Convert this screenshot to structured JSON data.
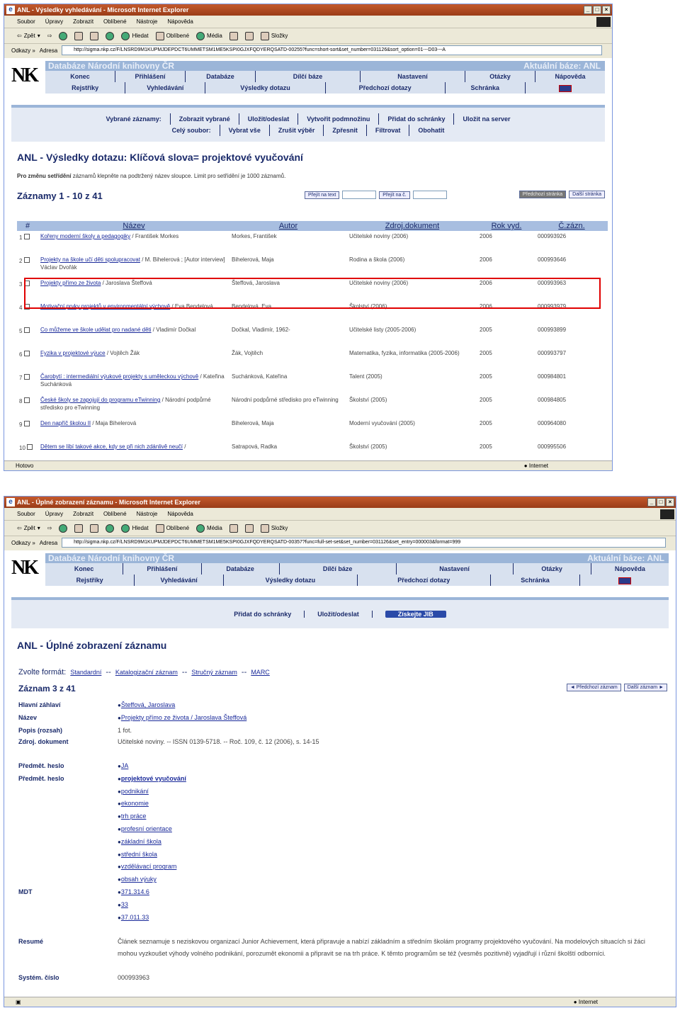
{
  "window1": {
    "title": "ANL - Výsledky vyhledávání - Microsoft Internet Explorer",
    "menu": [
      "Soubor",
      "Úpravy",
      "Zobrazit",
      "Oblíbené",
      "Nástroje",
      "Nápověda"
    ],
    "toolbar": {
      "back": "Zpět",
      "search": "Hledat",
      "favorites": "Oblíbené",
      "media": "Média",
      "links": "Složky"
    },
    "address_label": "Odkazy »",
    "address_field_label": "Adresa",
    "url": "http://sigma.nkp.cz/F/LNSRD9M1KUPMJDEPDCT6UMMETSM1ME5KSPI0GJXFQDYERQSATD-00255?func=short-sort&set_number=031126&sort_option=01---D03---A",
    "status": "Hotovo",
    "zone": "Internet"
  },
  "window2": {
    "title": "ANL - Úplné zobrazení záznamu - Microsoft Internet Explorer",
    "url": "http://sigma.nkp.cz/F/LNSRD9M1KUPMJDEPDCT6UMMETSM1ME5KSPI0GJXFQDYERQSATD-00357?func=full-set-set&set_number=031126&set_entry=000003&format=999",
    "zone": "Internet"
  },
  "header": {
    "logo": "NK",
    "band_title": "Databáze Národní knihovny ČR",
    "current_db_label": "Aktuální báze:",
    "current_db": "ANL",
    "nav_top": [
      "Konec",
      "Přihlášení",
      "Databáze",
      "Dílčí báze",
      "Nastavení",
      "Otázky",
      "Nápověda"
    ],
    "nav_bottom": [
      "Rejstříky",
      "Vyhledávání",
      "Výsledky dotazu",
      "Předchozí dotazy",
      "Schránka"
    ]
  },
  "results_page": {
    "actions_row1_label": "Vybrané záznamy:",
    "actions_row1": [
      "Zobrazit vybrané",
      "Uložit/odeslat",
      "Vytvořit podmnožinu",
      "Přidat do schránky",
      "Uložit na server"
    ],
    "actions_row2_label": "Celý soubor:",
    "actions_row2": [
      "Vybrat vše",
      "Zrušit výběr",
      "Zpřesnit",
      "Filtrovat",
      "Obohatit"
    ],
    "title": "ANL - Výsledky dotazu:  Klíčová slova= projektové vyučování",
    "note_bold": "Pro změnu setřídění",
    "note_rest": " záznamů klepněte na podtržený název sloupce. Limit pro setřídění je 1000 záznamů.",
    "records": "Záznamy 1 - 10 z 41",
    "goto_set": "Přejít na text",
    "goto_record": "Přejít na č.",
    "prev_page": "Předchozí stránka",
    "next_page": "Další stránka",
    "columns": [
      "#",
      "Název",
      "Autor",
      "Zdroj.dokument",
      "Rok vyd.",
      "Č.zázn."
    ],
    "rows": [
      {
        "n": "1",
        "title": "Kořeny moderní školy a pedagogiky",
        "rest": " / František Morkes",
        "author": "Morkes, František",
        "source": "Učitelské noviny (2006)",
        "year": "2006",
        "id": "000993926"
      },
      {
        "n": "2",
        "title": "Projekty na škole učí děti spolupracovat",
        "rest": " / M. Bihelerová ; [Autor interview] Václav Dvořák",
        "author": "Bihelerová, Maja",
        "source": "Rodina a škola (2006)",
        "year": "2006",
        "id": "000993646"
      },
      {
        "n": "3",
        "title": "Projekty přímo ze života",
        "rest": " / Jaroslava Šteffová",
        "author": "Šteffová, Jaroslava",
        "source": "Učitelské noviny (2006)",
        "year": "2006",
        "id": "000993963"
      },
      {
        "n": "4",
        "title": "Motivační prvky projektů v environmentální výchově",
        "rest": " / Eva Bendelová",
        "author": "Bendelová, Eva",
        "source": "Školství (2006)",
        "year": "2006",
        "id": "000993979"
      },
      {
        "n": "5",
        "title": "Co můžeme ve škole udělat pro nadané děti",
        "rest": " / Vladimír Dočkal",
        "author": "Dočkal, Vladimír, 1962-",
        "source": "Učitelské listy (2005-2006)",
        "year": "2005",
        "id": "000993899"
      },
      {
        "n": "6",
        "title": "Fyzika v projektové výuce",
        "rest": " / Vojtěch Žák",
        "author": "Žák, Vojtěch",
        "source": "Matematika, fyzika, informatika (2005-2006)",
        "year": "2005",
        "id": "000993797"
      },
      {
        "n": "7",
        "title": "Čarobytí : intermediální výukové projekty s uměleckou výchově",
        "rest": " / Kateřina Suchánková",
        "author": "Suchánková, Kateřina",
        "source": "Talent (2005)",
        "year": "2005",
        "id": "000984801"
      },
      {
        "n": "8",
        "title": "České školy se zapojují do programu eTwinning",
        "rest": " / Národní podpůrné středisko pro eTwinning",
        "author": "Národní podpůrné středisko pro eTwinning",
        "source": "Školství (2005)",
        "year": "2005",
        "id": "000984805"
      },
      {
        "n": "9",
        "title": "Den napříč školou II",
        "rest": " / Maja Bihelerová",
        "author": "Bihelerová, Maja",
        "source": "Moderní vyučování (2005)",
        "year": "2005",
        "id": "000964080"
      },
      {
        "n": "10",
        "title": "Dětem se líbí takové akce, kdy se při nich zdánlivě neučí",
        "rest": " /",
        "author": "Satrapová, Radka",
        "source": "Školství (2005)",
        "year": "2005",
        "id": "000995506"
      }
    ]
  },
  "detail_page": {
    "actions": [
      "Přidat do schránky",
      "Uložit/odeslat"
    ],
    "jib": "Získejte JIB",
    "title": "ANL - Úplné zobrazení záznamu",
    "format_label": "Zvolte formát:",
    "formats": [
      "Standardní",
      "Katalogizační záznam",
      "Stručný záznam",
      "MARC"
    ],
    "record": "Záznam 3 z 41",
    "prev_record": "◄ Předchozí záznam",
    "next_record": "Další záznam ►",
    "fields": {
      "main_heading_label": "Hlavní záhlaví",
      "main_heading": "Šteffová, Jaroslava",
      "title_label": "Název",
      "title": "Projekty přímo ze života / Jaroslava Šteffová",
      "extent_label": "Popis (rozsah)",
      "extent": "1 fot.",
      "source_label": "Zdroj. dokument",
      "source": "Učitelské noviny. -- ISSN 0139-5718. -- Roč. 109, č. 12 (2006), s. 14-15",
      "subject1_label": "Předmět. heslo",
      "subject1": "JA",
      "subject2_label": "Předmět. heslo",
      "subjects": [
        "projektové vyučování",
        "podnikání",
        "ekonomie",
        "trh práce",
        "profesní orientace",
        "základní škola",
        "střední škola",
        "vzdělávací program",
        "obsah výuky"
      ],
      "mdt_label": "MDT",
      "mdt": [
        "371.314.6",
        "33",
        "37.011.33"
      ],
      "resume_label": "Resumé",
      "resume": "Článek seznamuje s neziskovou organizací Junior Achievement, která připravuje a nabízí základním a středním školám programy projektového vyučování. Na modelových situacích si žáci mohou vyzkoušet výhody volného podnikání, porozumět ekonomii a připravit se na trh práce. K těmto programům se též (vesměs pozitivně) vyjadřují i různí školští odborníci.",
      "sysno_label": "Systém. číslo",
      "sysno": "000993963"
    }
  },
  "colors": {
    "title_bar": "#b84a22",
    "nav_bg": "#d8e1ef",
    "band": "#9bb5d8",
    "header_blue": "#1a2a6a",
    "highlight": "#e00000"
  }
}
